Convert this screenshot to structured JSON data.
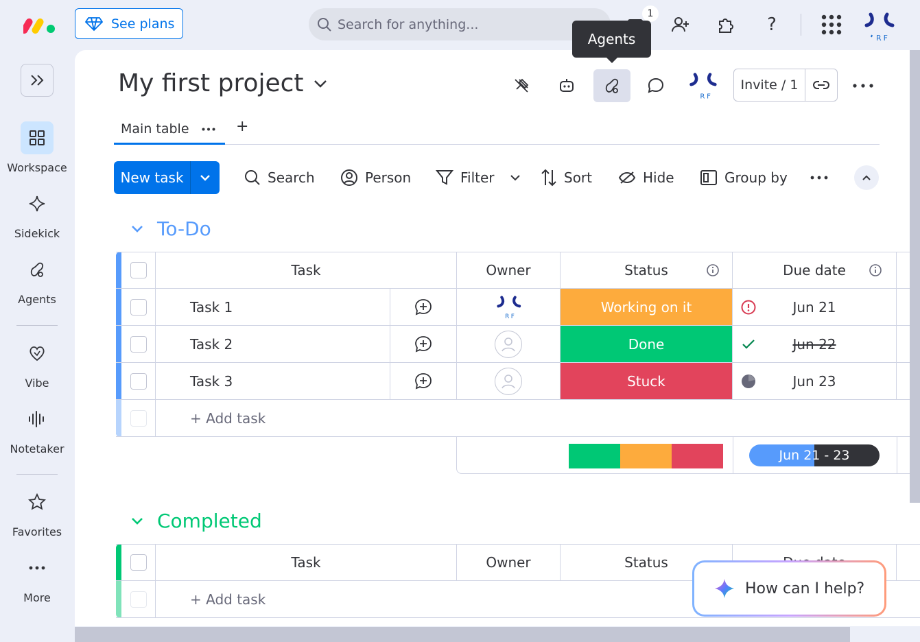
{
  "topbar": {
    "see_plans": "See plans",
    "search_placeholder": "Search for anything...",
    "notification_count": "1"
  },
  "tooltip": {
    "text": "Agents"
  },
  "rail": {
    "items": [
      {
        "label": "Workspace"
      },
      {
        "label": "Sidekick"
      },
      {
        "label": "Agents"
      },
      {
        "label": "Vibe"
      },
      {
        "label": "Notetaker"
      },
      {
        "label": "Favorites"
      },
      {
        "label": "More"
      }
    ]
  },
  "board": {
    "title": "My first project",
    "invite_label": "Invite / 1",
    "tabs": [
      {
        "label": "Main table"
      }
    ],
    "add_tab": "+"
  },
  "toolbar": {
    "new_task": "New task",
    "search": "Search",
    "person": "Person",
    "filter": "Filter",
    "sort": "Sort",
    "hide": "Hide",
    "group_by": "Group by"
  },
  "columns": {
    "task": "Task",
    "owner": "Owner",
    "status": "Status",
    "due_date": "Due date"
  },
  "groups": [
    {
      "title": "To-Do",
      "color": "#579bfc",
      "rows": [
        {
          "task": "Task 1",
          "status": "Working on it",
          "status_color": "#fdab3d",
          "due": "Jun 21",
          "due_state": "overdue"
        },
        {
          "task": "Task 2",
          "status": "Done",
          "status_color": "#00c875",
          "due": "Jun 22",
          "due_state": "done"
        },
        {
          "task": "Task 3",
          "status": "Stuck",
          "status_color": "#e2445c",
          "due": "Jun 23",
          "due_state": "pending"
        }
      ],
      "add_task": "+ Add task",
      "summary": {
        "status_distribution": [
          {
            "status": "Done",
            "color": "#00c875",
            "fraction": 0.3333
          },
          {
            "status": "Working on it",
            "color": "#fdab3d",
            "fraction": 0.3333
          },
          {
            "status": "Stuck",
            "color": "#e2445c",
            "fraction": 0.3334
          }
        ],
        "date_range": "Jun 21 - 23"
      }
    },
    {
      "title": "Completed",
      "color": "#00c875",
      "rows": [],
      "add_task": "+ Add task"
    }
  ],
  "help": {
    "text": "How can I help?"
  },
  "colors": {
    "primary": "#0073ea",
    "todo": "#579bfc",
    "completed": "#00c875"
  }
}
